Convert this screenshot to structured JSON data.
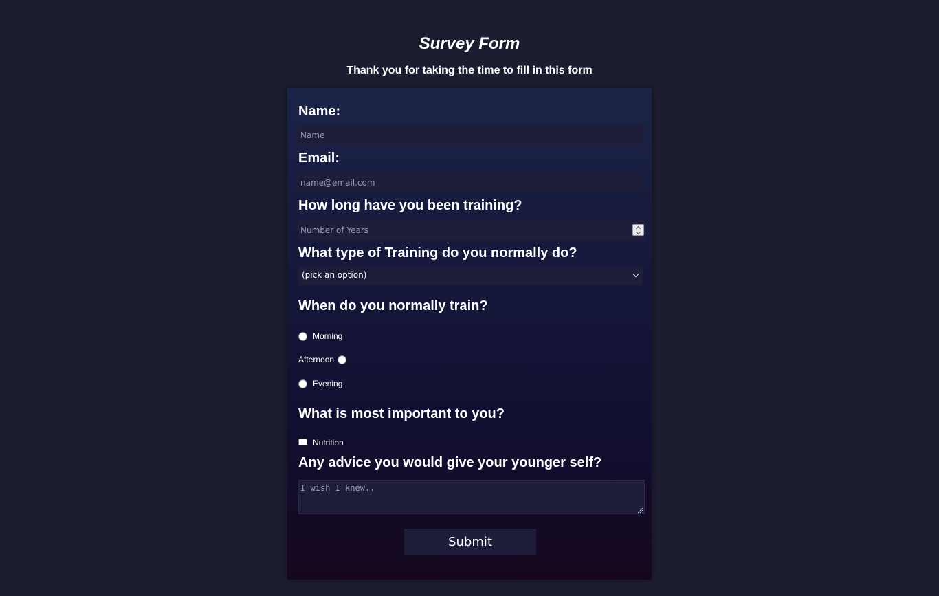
{
  "header": {
    "title": "Survey Form",
    "description": "Thank you for taking the time to fill in this form"
  },
  "form": {
    "name": {
      "label": "Name:",
      "placeholder": "Name"
    },
    "email": {
      "label": "Email:",
      "placeholder": "name@email.com"
    },
    "years": {
      "label": "How long have you been training?",
      "placeholder": "Number of Years"
    },
    "training_type": {
      "label": "What type of Training do you normally do?",
      "selected": "(pick an option)"
    },
    "when": {
      "label": "When do you normally train?",
      "options": [
        "Morning",
        "Afternoon",
        "Evening"
      ]
    },
    "important": {
      "label": "What is most important to you?",
      "options": [
        "Nutrition"
      ]
    },
    "advice": {
      "label": "Any advice you would give your younger self?",
      "placeholder": "I wish I knew.."
    },
    "submit_label": "Submit"
  },
  "colors": {
    "page_background": "#1d1d31",
    "input_background": "#1e1e3a",
    "text": "#ffffff"
  }
}
